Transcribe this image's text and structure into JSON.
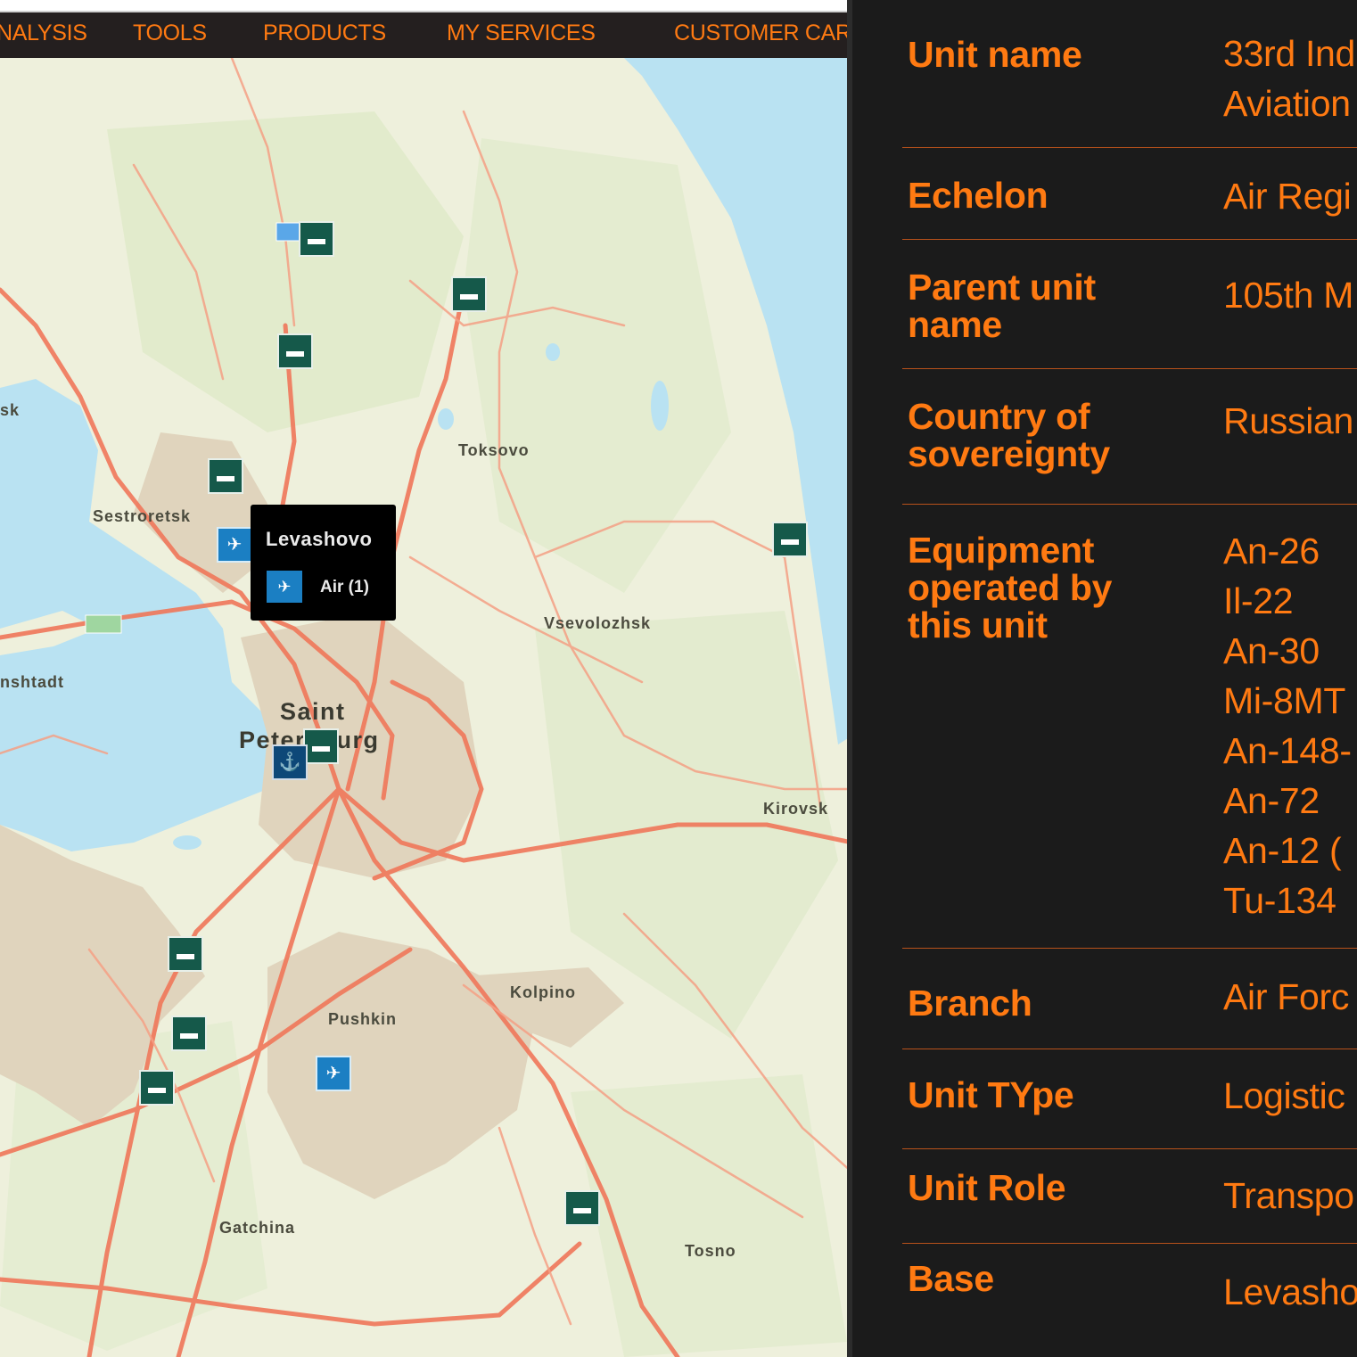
{
  "nav": {
    "items": [
      "NALYSIS",
      "TOOLS",
      "PRODUCTS",
      "MY SERVICES",
      "CUSTOMER CAR"
    ]
  },
  "map": {
    "places": {
      "sestroretsk": "Sestroretsk",
      "toksovo": "Toksovo",
      "vsevolozhsk": "Vsevolozhsk",
      "saint_petersburg_line1": "Saint",
      "saint_petersburg_line2": "Petersburg",
      "kolpino": "Kolpino",
      "pushkin": "Pushkin",
      "kirovsk": "Kirovsk",
      "gatchina": "Gatchina",
      "tosno": "Tosno",
      "edge_left_1": "sk",
      "edge_left_2": "nshtadt"
    },
    "tooltip": {
      "title": "Levashovo",
      "count_label": "Air (1)"
    },
    "colors": {
      "water": "#b9e2f2",
      "land": "#eef0dc",
      "urban": "#e0d4bd",
      "roads": "#f0775a",
      "ground_marker": "#15594a",
      "air_marker": "#1b7fc3",
      "navy_marker": "#0d4878"
    }
  },
  "details": {
    "rows": [
      {
        "label": "Unit name",
        "value": "33rd Ind\nAviation"
      },
      {
        "label": "Echelon",
        "value": "Air Regi"
      },
      {
        "label": "Parent unit\nname",
        "value": "105th M"
      },
      {
        "label": "Country of\nsovereignty",
        "value": "Russian"
      },
      {
        "label": "Equipment\noperated by\nthis unit",
        "value": "An-26\nIl-22\nAn-30\nMi-8MT\nAn-148-\nAn-72\nAn-12 (\nTu-134"
      },
      {
        "label": "Branch",
        "value": "Air Forc"
      },
      {
        "label": "Unit TYpe",
        "value": "Logistic"
      },
      {
        "label": "Unit Role",
        "value": "Transpo"
      },
      {
        "label": "Base",
        "value": "Levasho"
      }
    ]
  }
}
